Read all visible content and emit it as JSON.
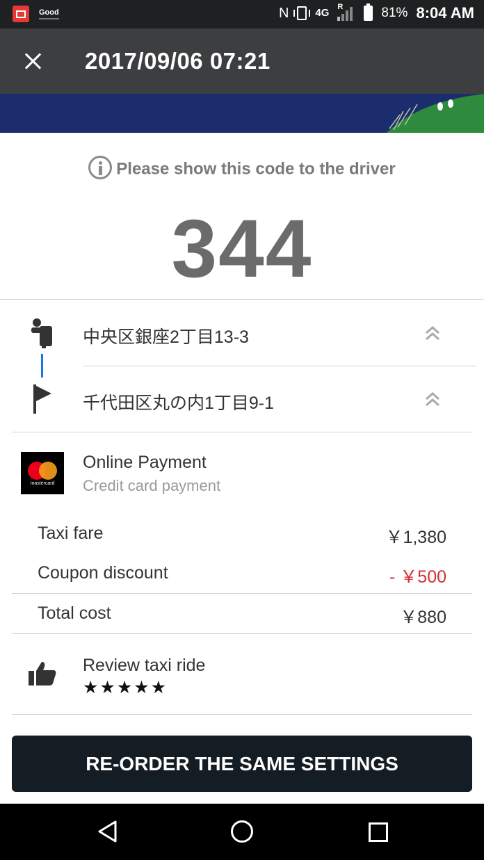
{
  "status_bar": {
    "notif_app": "Good",
    "network": "4G",
    "roaming": "R",
    "battery": "81%",
    "time": "8:04 AM"
  },
  "app_bar": {
    "title": "2017/09/06 07:21"
  },
  "code_section": {
    "notice": "Please show this code to the driver",
    "code": "344"
  },
  "route": {
    "pickup": "中央区銀座2丁目13-3",
    "dropoff": "千代田区丸の内1丁目9-1"
  },
  "payment": {
    "brand": "mastercard",
    "title": "Online Payment",
    "subtitle": "Credit card payment"
  },
  "fare": {
    "taxi_fare_label": "Taxi fare",
    "taxi_fare_value": "￥1,380",
    "coupon_label": "Coupon discount",
    "coupon_value": "- ￥500",
    "total_label": "Total cost",
    "total_value": "￥880"
  },
  "review": {
    "title": "Review taxi ride",
    "stars": "★★★★★"
  },
  "actions": {
    "reorder_label": "RE-ORDER THE SAME SETTINGS"
  },
  "colors": {
    "app_bar": "#3c3e40",
    "banner": "#1b2d6c",
    "route_line": "#1a73e8",
    "discount": "#d32f2f",
    "button": "#151d24"
  }
}
